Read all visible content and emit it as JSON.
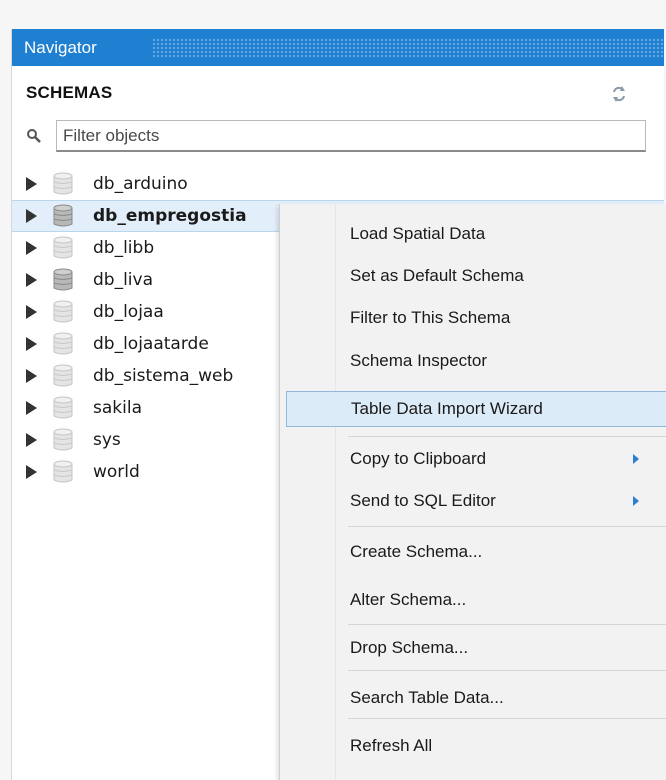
{
  "navigator": {
    "title": "Navigator",
    "schemas_label": "SCHEMAS",
    "filter": {
      "placeholder": "Filter objects"
    },
    "schemas": [
      {
        "name": "db_arduino",
        "selected": false
      },
      {
        "name": "db_empregostia",
        "selected": true
      },
      {
        "name": "db_libb",
        "selected": false
      },
      {
        "name": "db_liva",
        "selected": false
      },
      {
        "name": "db_lojaa",
        "selected": false
      },
      {
        "name": "db_lojaatarde",
        "selected": false
      },
      {
        "name": "db_sistema_web",
        "selected": false
      },
      {
        "name": "sakila",
        "selected": false
      },
      {
        "name": "sys",
        "selected": false
      },
      {
        "name": "world",
        "selected": false
      }
    ]
  },
  "context_menu": {
    "items": [
      {
        "label": "Load Spatial Data"
      },
      {
        "label": "Set as Default Schema"
      },
      {
        "label": "Filter to This Schema"
      },
      {
        "label": "Schema Inspector"
      },
      {
        "label": "Table Data Import Wizard",
        "highlighted": true
      },
      {
        "label": "Copy to Clipboard",
        "submenu": true
      },
      {
        "label": "Send to SQL Editor",
        "submenu": true
      },
      {
        "label": "Create Schema..."
      },
      {
        "label": "Alter Schema..."
      },
      {
        "label": "Drop Schema..."
      },
      {
        "label": "Search Table Data..."
      },
      {
        "label": "Refresh All"
      }
    ]
  },
  "colors": {
    "header_blue": "#1f7fd0",
    "selection": "#e2effa",
    "menu_highlight": "#dcebf8",
    "submenu_arrow": "#2d7fd3"
  }
}
